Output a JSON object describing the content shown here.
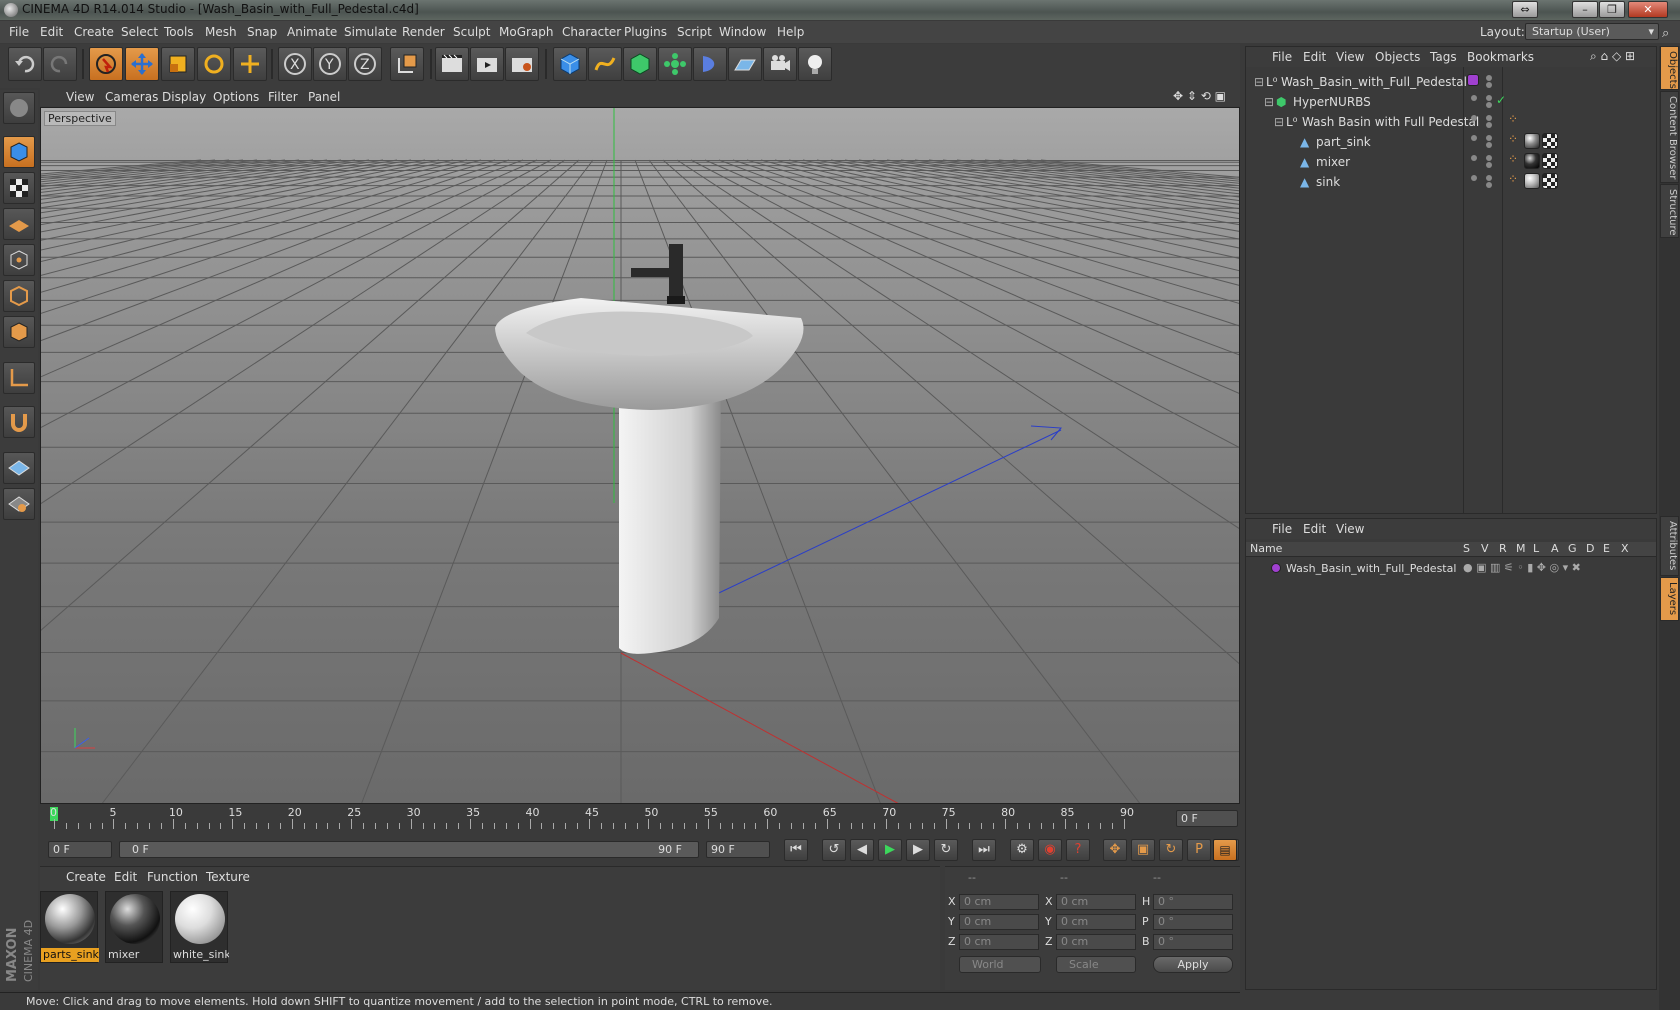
{
  "window": {
    "title": "CINEMA 4D R14.014 Studio - [Wash_Basin_with_Full_Pedestal.c4d]"
  },
  "menu": [
    "File",
    "Edit",
    "Create",
    "Select",
    "Tools",
    "Mesh",
    "Snap",
    "Animate",
    "Simulate",
    "Render",
    "Sculpt",
    "MoGraph",
    "Character",
    "Plugins",
    "Script",
    "Window",
    "Help"
  ],
  "layout": {
    "label": "Layout:",
    "value": "Startup (User)"
  },
  "viewport": {
    "menu": [
      "View",
      "Cameras",
      "Display",
      "Options",
      "Filter",
      "Panel"
    ],
    "label": "Perspective"
  },
  "timeline": {
    "ticks": [
      "0",
      "5",
      "10",
      "15",
      "20",
      "25",
      "30",
      "35",
      "40",
      "45",
      "50",
      "55",
      "60",
      "65",
      "70",
      "75",
      "80",
      "85",
      "90"
    ],
    "current_frame": "0 F",
    "start": "0 F",
    "range_start": "0 F",
    "range_end": "90 F",
    "end": "90 F"
  },
  "materials": {
    "menu": [
      "Create",
      "Edit",
      "Function",
      "Texture"
    ],
    "items": [
      {
        "name": "parts_sink"
      },
      {
        "name": "mixer"
      },
      {
        "name": "white_sink"
      }
    ]
  },
  "coords": {
    "headers": [
      "--",
      "--",
      "--"
    ],
    "pos_labels": [
      "X",
      "Y",
      "Z"
    ],
    "pos": [
      "0 cm",
      "0 cm",
      "0 cm"
    ],
    "size_labels": [
      "X",
      "Y",
      "Z"
    ],
    "size": [
      "0 cm",
      "0 cm",
      "0 cm"
    ],
    "rot_labels": [
      "H",
      "P",
      "B"
    ],
    "rot": [
      "0 °",
      "0 °",
      "0 °"
    ],
    "world": "World",
    "scale": "Scale",
    "apply": "Apply"
  },
  "status": "Move: Click and drag to move elements. Hold down SHIFT to quantize movement / add to the selection in point mode, CTRL to remove.",
  "objects": {
    "menu": [
      "File",
      "Edit",
      "View",
      "Objects",
      "Tags",
      "Bookmarks"
    ],
    "rows": [
      {
        "name": "Wash_Basin_with_Full_Pedestal"
      },
      {
        "name": "HyperNURBS"
      },
      {
        "name": "Wash Basin with Full Pedestal"
      },
      {
        "name": "part_sink"
      },
      {
        "name": "mixer"
      },
      {
        "name": "sink"
      }
    ]
  },
  "layers": {
    "menu": [
      "File",
      "Edit",
      "View"
    ],
    "header": {
      "name": "Name",
      "cols": [
        "S",
        "V",
        "R",
        "M",
        "L",
        "A",
        "G",
        "D",
        "E",
        "X"
      ]
    },
    "rows": [
      {
        "name": "Wash_Basin_with_Full_Pedestal",
        "color": "#a040d0"
      }
    ]
  },
  "right_tabs": [
    "Objects",
    "Content Browser",
    "Structure",
    "Attributes",
    "Layers"
  ],
  "brand": {
    "line1": "MAXON",
    "line2": "CINEMA 4D"
  }
}
